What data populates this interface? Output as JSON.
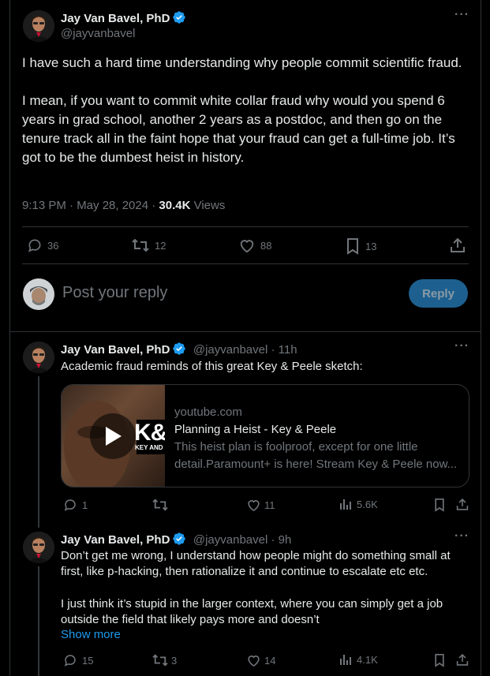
{
  "main_tweet": {
    "author_name": "Jay Van Bavel, PhD",
    "author_handle": "@jayvanbavel",
    "text_p1": "I have such a hard time understanding why people commit scientific fraud.",
    "text_p2": "I mean, if you want to commit white collar fraud why would you spend 6 years in grad school, another 2 years as a postdoc, and then go on the tenure track all in the faint hope that your fraud can get a full-time job. It’s got to be the dumbest heist in history.",
    "time": "9:13 PM · May 28, 2024 · ",
    "views_count": "30.4K",
    "views_label": " Views",
    "replies": "36",
    "reposts": "12",
    "likes": "88",
    "bookmarks": "13"
  },
  "composer": {
    "placeholder": "Post your reply",
    "reply_button": "Reply"
  },
  "replies": [
    {
      "author_name": "Jay Van Bavel, PhD",
      "author_handle": "@jayvanbavel · 11h",
      "text": "Academic fraud reminds of this great Key & Peele sketch:",
      "card": {
        "domain": "youtube.com",
        "title": "Planning a Heist - Key & Peele",
        "description": "This heist plan is foolproof, except for one little detail.Paramount+ is here! Stream Key & Peele now...",
        "thumb_text": "K&",
        "thumb_sub": "KEY AND"
      },
      "replies": "1",
      "reposts": "",
      "likes": "11",
      "views": "5.6K"
    },
    {
      "author_name": "Jay Van Bavel, PhD",
      "author_handle": "@jayvanbavel · 9h",
      "text_p1": "Don’t get me wrong, I understand how people might do something small at first, like p-hacking, then rationalize it and continue to escalate etc etc.",
      "text_p2": "I just think it’s stupid in the larger context, where you can simply get a job outside the field that likely pays more and doesn’t",
      "show_more": "Show more",
      "replies": "15",
      "reposts": "3",
      "likes": "14",
      "views": "4.1K"
    }
  ],
  "colors": {
    "background": "#000000",
    "text": "#e7e9ea",
    "muted": "#71767b",
    "accent": "#1d9bf0",
    "reply_button_bg": "#1d608f"
  }
}
